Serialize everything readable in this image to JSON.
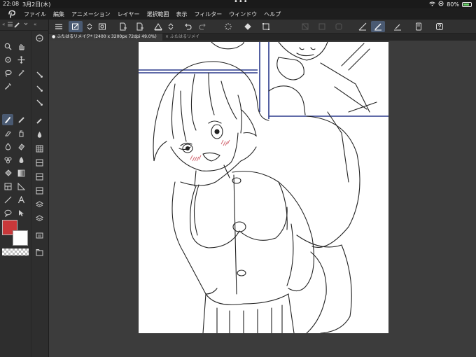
{
  "status": {
    "time": "22:08",
    "date": "3月2日(木)",
    "battery": "80%",
    "battery_level": 0.8,
    "handle_dots": "•••"
  },
  "menu": {
    "items": [
      "ファイル",
      "編集",
      "アニメーション",
      "レイヤー",
      "選択範囲",
      "表示",
      "フィルター",
      "ウィンドウ",
      "ヘルプ"
    ]
  },
  "tabs": {
    "active": "ふたはるリメイク* (2400 x 3200px 72dpi 49.0%)",
    "inactive": "ふたはるリメイ",
    "active_marker": "●",
    "close_glyph": "×"
  },
  "panel": {
    "collapse_left": "«",
    "collapse_right": "«"
  },
  "colors": {
    "main": "#c8383a",
    "sub": "#ffffff",
    "accent": "#4a5a72",
    "frame_line": "#2b3a8c"
  },
  "toolbar_icons": [
    "menu-icon",
    "new-layer-icon",
    "stepper-icon",
    "frame-icon",
    "page-add-icon",
    "page-remove-icon",
    "triangle-icon",
    "stepper-icon",
    "undo-icon",
    "redo-icon",
    "spinner-icon",
    "fill-icon",
    "transform-icon",
    "disabled-icon",
    "disabled-icon",
    "disabled-icon",
    "ruler-icon",
    "pen-ruler-icon",
    "baseline-icon",
    "tablet-icon",
    "help-icon"
  ]
}
